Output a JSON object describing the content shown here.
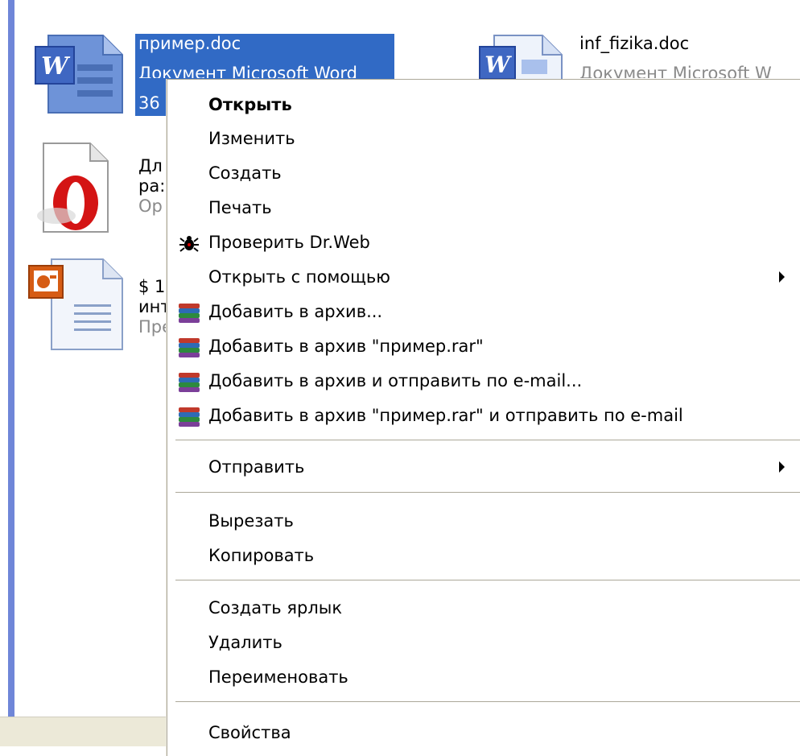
{
  "files": [
    {
      "name": "пример.doc",
      "type": "Документ Microsoft Word",
      "size": "36",
      "icon": "word-doc-icon"
    },
    {
      "name": "inf_fizika.doc",
      "type": "Документ Microsoft W",
      "icon": "word-doc-icon"
    },
    {
      "line1": "Дл",
      "line2": "ра:",
      "line3": "Op",
      "icon": "opera-doc-icon"
    },
    {
      "line1": "$ 1",
      "line2": "инт",
      "line3": "Пре",
      "icon": "powerpoint-doc-icon"
    }
  ],
  "context_menu": {
    "items": [
      {
        "label": "Открыть",
        "bold": true
      },
      {
        "label": "Изменить"
      },
      {
        "label": "Создать"
      },
      {
        "label": "Печать"
      },
      {
        "label": "Проверить Dr.Web",
        "icon": "drweb-spider-icon"
      },
      {
        "label": "Открыть с помощью",
        "submenu": true
      },
      {
        "label": "Добавить в архив...",
        "icon": "winrar-archive-icon"
      },
      {
        "label": "Добавить в архив \"пример.rar\"",
        "icon": "winrar-archive-icon"
      },
      {
        "label": "Добавить в архив и отправить по e-mail...",
        "icon": "winrar-archive-icon"
      },
      {
        "label": "Добавить в архив \"пример.rar\" и отправить по e-mail",
        "icon": "winrar-archive-icon"
      },
      {
        "label": "Отправить",
        "submenu": true
      },
      {
        "label": "Вырезать"
      },
      {
        "label": "Копировать"
      },
      {
        "label": "Создать ярлык"
      },
      {
        "label": "Удалить"
      },
      {
        "label": "Переименовать"
      },
      {
        "label": "Свойства"
      }
    ]
  },
  "colors": {
    "selection": "#316ac5",
    "window_accent": "#6f86d8",
    "menu_border": "#aca899"
  }
}
